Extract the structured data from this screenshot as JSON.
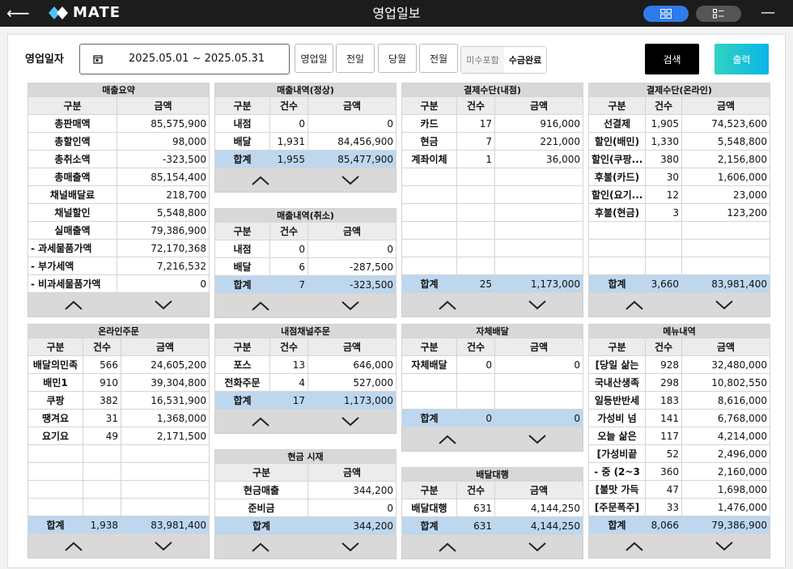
{
  "header": {
    "title": "영업일보",
    "brand": "MATE"
  },
  "filter": {
    "label": "영업일자",
    "date_range": "2025.05.01 ~ 2025.05.31",
    "quick_buttons": [
      "영업일",
      "전일",
      "당월",
      "전월"
    ],
    "toggle_off": "미수포함",
    "toggle_on": "수금완료",
    "search": "검색",
    "print": "출력"
  },
  "colors": {
    "total_row": "#bdd7ee",
    "search_btn": "#000000",
    "print_btn": "#16c2d8",
    "topbar": "#1c1c1c",
    "view_active": "#2f7bea"
  },
  "summary": {
    "title": "매출요약",
    "cols": [
      "구분",
      "금액"
    ],
    "rows": [
      {
        "label": "총판매액",
        "amount": "85,575,900"
      },
      {
        "label": "총할인액",
        "amount": "98,000"
      },
      {
        "label": "총취소액",
        "amount": "-323,500"
      },
      {
        "label": "총매출액",
        "amount": "85,154,400"
      },
      {
        "label": "채널배달료",
        "amount": "218,700"
      },
      {
        "label": "채널할인",
        "amount": "5,548,800"
      },
      {
        "label": "실매출액",
        "amount": "79,386,900"
      },
      {
        "label": "- 과세물품가액",
        "amount": "72,170,368"
      },
      {
        "label": "- 부가세액",
        "amount": "7,216,532"
      },
      {
        "label": "- 비과세물품가액",
        "amount": "0"
      }
    ]
  },
  "sales_normal": {
    "title": "매출내역(정상)",
    "cols": [
      "구분",
      "건수",
      "금액"
    ],
    "rows": [
      {
        "label": "내점",
        "count": "0",
        "amount": "0"
      },
      {
        "label": "배달",
        "count": "1,931",
        "amount": "84,456,900"
      }
    ],
    "total": {
      "label": "합계",
      "count": "1,955",
      "amount": "85,477,900"
    }
  },
  "sales_cancel": {
    "title": "매출내역(취소)",
    "cols": [
      "구분",
      "건수",
      "금액"
    ],
    "rows": [
      {
        "label": "내점",
        "count": "0",
        "amount": "0"
      },
      {
        "label": "배달",
        "count": "6",
        "amount": "-287,500"
      }
    ],
    "total": {
      "label": "합계",
      "count": "7",
      "amount": "-323,500"
    }
  },
  "pay_store": {
    "title": "결제수단(내점)",
    "cols": [
      "구분",
      "건수",
      "금액"
    ],
    "rows": [
      {
        "label": "카드",
        "count": "17",
        "amount": "916,000"
      },
      {
        "label": "현금",
        "count": "7",
        "amount": "221,000"
      },
      {
        "label": "계좌이체",
        "count": "1",
        "amount": "36,000"
      }
    ],
    "total": {
      "label": "합계",
      "count": "25",
      "amount": "1,173,000"
    }
  },
  "pay_online": {
    "title": "결제수단(온라인)",
    "cols": [
      "구분",
      "건수",
      "금액"
    ],
    "rows": [
      {
        "label": "선결제",
        "count": "1,905",
        "amount": "74,523,600"
      },
      {
        "label": "할인(배민)",
        "count": "1,330",
        "amount": "5,548,800"
      },
      {
        "label": "할인(쿠팡...",
        "count": "380",
        "amount": "2,156,800"
      },
      {
        "label": "후불(카드)",
        "count": "30",
        "amount": "1,606,000"
      },
      {
        "label": "할인(요기...",
        "count": "12",
        "amount": "23,000"
      },
      {
        "label": "후불(현금)",
        "count": "3",
        "amount": "123,200"
      }
    ],
    "total": {
      "label": "합계",
      "count": "3,660",
      "amount": "83,981,400"
    }
  },
  "online_order": {
    "title": "온라인주문",
    "cols": [
      "구분",
      "건수",
      "금액"
    ],
    "rows": [
      {
        "label": "배달의민족",
        "count": "566",
        "amount": "24,605,200"
      },
      {
        "label": "배민1",
        "count": "910",
        "amount": "39,304,800"
      },
      {
        "label": "쿠팡",
        "count": "382",
        "amount": "16,531,900"
      },
      {
        "label": "땡겨요",
        "count": "31",
        "amount": "1,368,000"
      },
      {
        "label": "요기요",
        "count": "49",
        "amount": "2,171,500"
      }
    ],
    "total": {
      "label": "합계",
      "count": "1,938",
      "amount": "83,981,400"
    }
  },
  "store_channel": {
    "title": "내점채널주문",
    "cols": [
      "구분",
      "건수",
      "금액"
    ],
    "rows": [
      {
        "label": "포스",
        "count": "13",
        "amount": "646,000"
      },
      {
        "label": "전화주문",
        "count": "4",
        "amount": "527,000"
      }
    ],
    "total": {
      "label": "합계",
      "count": "17",
      "amount": "1,173,000"
    }
  },
  "cash_drawer": {
    "title": "현금 시재",
    "cols": [
      "구분",
      "금액"
    ],
    "rows": [
      {
        "label": "현금매출",
        "amount": "344,200"
      },
      {
        "label": "준비금",
        "amount": "0"
      }
    ],
    "total": {
      "label": "합계",
      "amount": "344,200"
    }
  },
  "self_delivery": {
    "title": "자체배달",
    "cols": [
      "구분",
      "건수",
      "금액"
    ],
    "rows": [
      {
        "label": "자체배달",
        "count": "0",
        "amount": "0"
      }
    ],
    "total": {
      "label": "합계",
      "count": "0",
      "amount": "0"
    }
  },
  "delivery_agent": {
    "title": "배달대행",
    "cols": [
      "구분",
      "건수",
      "금액"
    ],
    "rows": [
      {
        "label": "배달대행",
        "count": "631",
        "amount": "4,144,250"
      }
    ],
    "total": {
      "label": "합계",
      "count": "631",
      "amount": "4,144,250"
    }
  },
  "menu": {
    "title": "메뉴내역",
    "cols": [
      "구분",
      "건수",
      "금액"
    ],
    "rows": [
      {
        "label": "[당일 삶는",
        "count": "928",
        "amount": "32,480,000"
      },
      {
        "label": "국내산생족",
        "count": "298",
        "amount": "10,802,550"
      },
      {
        "label": "일등반반세",
        "count": "183",
        "amount": "8,616,000"
      },
      {
        "label": "가성비 넘",
        "count": "141",
        "amount": "6,768,000"
      },
      {
        "label": "오늘 삶은",
        "count": "117",
        "amount": "4,214,000"
      },
      {
        "label": "[가성비끝",
        "count": "52",
        "amount": "2,496,000"
      },
      {
        "label": "- 중 (2~3",
        "count": "360",
        "amount": "2,160,000"
      },
      {
        "label": "[불맛 가득",
        "count": "47",
        "amount": "1,698,000"
      },
      {
        "label": "[주문폭주]",
        "count": "33",
        "amount": "1,476,000"
      }
    ],
    "total": {
      "label": "합계",
      "count": "8,066",
      "amount": "79,386,900"
    }
  }
}
